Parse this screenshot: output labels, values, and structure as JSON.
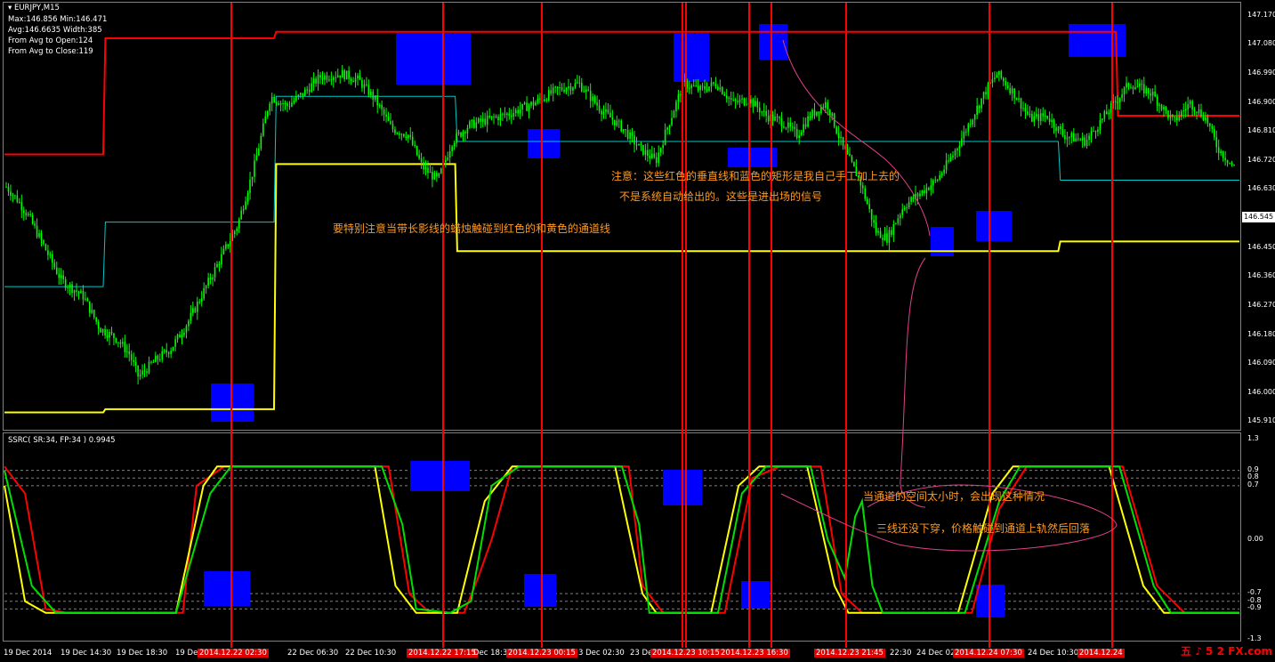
{
  "window": {
    "symbol": "EURJPY,M15",
    "stats": [
      "Max:146.856 Min:146.471",
      "Avg:146.6635 Width:385",
      "From Avg to Open:124",
      "From Avg to Close:119"
    ]
  },
  "indicator": {
    "label": "SSRC( SR:34, FP:34 ) 0.9945"
  },
  "notes": {
    "note1_line1": "注意：这些红色的垂直线和蓝色的矩形是我自己手工加上去的",
    "note1_line2": "不是系统自动给出的。这些是进出场的信号",
    "note2": "要特别注意当带长影线的蜡烛触碰到红色的和黄色的通道线",
    "note3": "当通道的空间太小时，会出现这种情况",
    "note4": "三线还没下穿，价格触碰到通道上轨然后回落"
  },
  "colors": {
    "candle": "#00ff00",
    "upper_channel": "#ff0000",
    "lower_channel": "#ffff00",
    "mid_channel": "#00c8c8",
    "signal_line": "#ff0000",
    "rect": "#0000ff",
    "annotation": "#ff9a1f",
    "curve": "#e0408a"
  },
  "chart_data": [
    {
      "type": "candlestick",
      "symbol": "EURJPY",
      "timeframe": "M15",
      "current_price": "146.545",
      "y_ticks": [
        "147.170",
        "147.080",
        "146.990",
        "146.900",
        "146.810",
        "146.720",
        "146.630",
        "146.545",
        "146.450",
        "146.360",
        "146.270",
        "146.180",
        "146.090",
        "146.000",
        "145.910"
      ],
      "ylim": [
        145.9,
        147.18
      ],
      "close_path": [
        [
          0,
          146.64
        ],
        [
          10,
          146.6
        ],
        [
          20,
          146.55
        ],
        [
          35,
          146.45
        ],
        [
          50,
          146.35
        ],
        [
          70,
          146.3
        ],
        [
          85,
          146.2
        ],
        [
          100,
          146.17
        ],
        [
          112,
          146.12
        ],
        [
          120,
          146.05
        ],
        [
          135,
          146.1
        ],
        [
          150,
          146.14
        ],
        [
          165,
          146.22
        ],
        [
          180,
          146.32
        ],
        [
          195,
          146.42
        ],
        [
          210,
          146.52
        ],
        [
          225,
          146.7
        ],
        [
          240,
          146.92
        ],
        [
          255,
          146.89
        ],
        [
          270,
          146.93
        ],
        [
          285,
          146.98
        ],
        [
          305,
          146.99
        ],
        [
          320,
          146.97
        ],
        [
          335,
          146.91
        ],
        [
          350,
          146.82
        ],
        [
          365,
          146.8
        ],
        [
          378,
          146.7
        ],
        [
          392,
          146.66
        ],
        [
          405,
          146.78
        ],
        [
          420,
          146.83
        ],
        [
          440,
          146.85
        ],
        [
          460,
          146.87
        ],
        [
          480,
          146.9
        ],
        [
          500,
          146.94
        ],
        [
          520,
          146.96
        ],
        [
          540,
          146.88
        ],
        [
          560,
          146.82
        ],
        [
          575,
          146.76
        ],
        [
          590,
          146.72
        ],
        [
          600,
          146.82
        ],
        [
          615,
          146.96
        ],
        [
          630,
          146.94
        ],
        [
          645,
          146.96
        ],
        [
          660,
          146.9
        ],
        [
          675,
          146.91
        ],
        [
          690,
          146.86
        ],
        [
          705,
          146.84
        ],
        [
          718,
          146.8
        ],
        [
          730,
          146.86
        ],
        [
          745,
          146.9
        ],
        [
          760,
          146.76
        ],
        [
          775,
          146.66
        ],
        [
          790,
          146.5
        ],
        [
          800,
          146.48
        ],
        [
          815,
          146.58
        ],
        [
          830,
          146.62
        ],
        [
          845,
          146.66
        ],
        [
          860,
          146.74
        ],
        [
          875,
          146.84
        ],
        [
          890,
          146.94
        ],
        [
          900,
          146.99
        ],
        [
          915,
          146.93
        ],
        [
          930,
          146.85
        ],
        [
          945,
          146.86
        ],
        [
          960,
          146.8
        ],
        [
          980,
          146.78
        ],
        [
          1000,
          146.87
        ],
        [
          1020,
          146.96
        ],
        [
          1040,
          146.93
        ],
        [
          1060,
          146.84
        ],
        [
          1075,
          146.9
        ],
        [
          1090,
          146.85
        ],
        [
          1100,
          146.76
        ],
        [
          1115,
          146.7
        ]
      ],
      "upper_channel": [
        [
          0,
          146.74
        ],
        [
          48,
          146.74
        ],
        [
          49,
          147.1
        ],
        [
          131,
          147.1
        ],
        [
          132,
          147.12
        ],
        [
          540,
          147.12
        ],
        [
          541,
          146.86
        ],
        [
          600,
          146.86
        ]
      ],
      "lower_channel": [
        [
          0,
          145.94
        ],
        [
          48,
          145.94
        ],
        [
          49,
          145.95
        ],
        [
          131,
          145.95
        ],
        [
          132,
          146.71
        ],
        [
          219,
          146.71
        ],
        [
          220,
          146.44
        ],
        [
          512,
          146.44
        ],
        [
          513,
          146.47
        ],
        [
          600,
          146.47
        ]
      ],
      "mid_channel": [
        [
          0,
          146.33
        ],
        [
          48,
          146.33
        ],
        [
          49,
          146.53
        ],
        [
          131,
          146.53
        ],
        [
          132,
          146.92
        ],
        [
          219,
          146.92
        ],
        [
          220,
          146.78
        ],
        [
          512,
          146.78
        ],
        [
          513,
          146.66
        ],
        [
          600,
          146.66
        ]
      ]
    },
    {
      "type": "line",
      "name": "SSRC( SR:34, FP:34 ) 0.9945",
      "y_ticks": [
        "1.3",
        "0.9",
        "0.8",
        "0.7",
        "0.00",
        "-0.7",
        "-0.8",
        "-0.9",
        "-1.3"
      ],
      "ylim": [
        -1.3,
        1.3
      ],
      "levels": [
        0.9,
        0.8,
        0.7,
        -0.7,
        -0.8,
        -0.9
      ],
      "green": [
        [
          0,
          0.9
        ],
        [
          8,
          -0.6
        ],
        [
          15,
          -0.95
        ],
        [
          50,
          -0.95
        ],
        [
          60,
          0.6
        ],
        [
          66,
          0.95
        ],
        [
          110,
          0.95
        ],
        [
          116,
          0.2
        ],
        [
          120,
          -0.9
        ],
        [
          130,
          -0.95
        ],
        [
          136,
          -0.8
        ],
        [
          142,
          0.7
        ],
        [
          150,
          0.95
        ],
        [
          180,
          0.95
        ],
        [
          185,
          0.2
        ],
        [
          188,
          -0.95
        ],
        [
          208,
          -0.95
        ],
        [
          215,
          0.6
        ],
        [
          222,
          0.95
        ],
        [
          235,
          0.95
        ],
        [
          240,
          0.0
        ],
        [
          245,
          -0.5
        ],
        [
          248,
          0.3
        ],
        [
          250,
          0.5
        ],
        [
          253,
          -0.6
        ],
        [
          256,
          -0.95
        ],
        [
          280,
          -0.95
        ],
        [
          290,
          0.5
        ],
        [
          296,
          0.95
        ],
        [
          325,
          0.95
        ],
        [
          335,
          -0.6
        ],
        [
          340,
          -0.95
        ],
        [
          360,
          -0.95
        ]
      ],
      "yellow": [
        [
          0,
          0.7
        ],
        [
          6,
          -0.8
        ],
        [
          12,
          -0.95
        ],
        [
          50,
          -0.95
        ],
        [
          58,
          0.7
        ],
        [
          62,
          0.95
        ],
        [
          108,
          0.95
        ],
        [
          114,
          -0.6
        ],
        [
          120,
          -0.95
        ],
        [
          132,
          -0.95
        ],
        [
          140,
          0.5
        ],
        [
          148,
          0.95
        ],
        [
          178,
          0.95
        ],
        [
          186,
          -0.7
        ],
        [
          190,
          -0.95
        ],
        [
          206,
          -0.95
        ],
        [
          214,
          0.7
        ],
        [
          220,
          0.95
        ],
        [
          234,
          0.95
        ],
        [
          242,
          -0.6
        ],
        [
          246,
          -0.95
        ],
        [
          278,
          -0.95
        ],
        [
          288,
          0.6
        ],
        [
          294,
          0.95
        ],
        [
          322,
          0.95
        ],
        [
          332,
          -0.6
        ],
        [
          338,
          -0.95
        ],
        [
          360,
          -0.95
        ]
      ],
      "red": [
        [
          0,
          0.95
        ],
        [
          6,
          0.6
        ],
        [
          12,
          -0.9
        ],
        [
          18,
          -0.95
        ],
        [
          52,
          -0.95
        ],
        [
          56,
          0.7
        ],
        [
          64,
          0.95
        ],
        [
          112,
          0.95
        ],
        [
          118,
          -0.7
        ],
        [
          124,
          -0.95
        ],
        [
          134,
          -0.95
        ],
        [
          138,
          -0.5
        ],
        [
          142,
          0.0
        ],
        [
          148,
          0.95
        ],
        [
          182,
          0.95
        ],
        [
          186,
          -0.6
        ],
        [
          192,
          -0.95
        ],
        [
          210,
          -0.95
        ],
        [
          218,
          0.8
        ],
        [
          226,
          0.95
        ],
        [
          238,
          0.95
        ],
        [
          244,
          -0.7
        ],
        [
          250,
          -0.95
        ],
        [
          282,
          -0.95
        ],
        [
          290,
          0.4
        ],
        [
          298,
          0.95
        ],
        [
          326,
          0.95
        ],
        [
          336,
          -0.6
        ],
        [
          344,
          -0.95
        ],
        [
          360,
          -0.95
        ]
      ]
    }
  ],
  "x_axis": {
    "labels": [
      "19 Dec 2014",
      "19 Dec 14:30",
      "19 Dec 18:30",
      "19 Dec",
      "2014.12.22 02:30",
      "22 Dec 06:30",
      "22 Dec 10:30",
      "2014.12.22 17:15",
      "Dec 18:30",
      "2014.12.23 00:15",
      "3 Dec 02:30",
      "23 Dec",
      "2014.12.23 10:15",
      "2014.12.23 16:30",
      "2014.12.23 21:45",
      "22:30",
      "24 Dec 02",
      "2014.12.24 07:30",
      "24 Dec 10:30",
      "2014.12.24"
    ],
    "highlighted": [
      false,
      false,
      false,
      false,
      true,
      false,
      false,
      true,
      false,
      true,
      false,
      false,
      true,
      true,
      true,
      false,
      false,
      true,
      false,
      true
    ]
  },
  "logo": "5 2 FX.com"
}
